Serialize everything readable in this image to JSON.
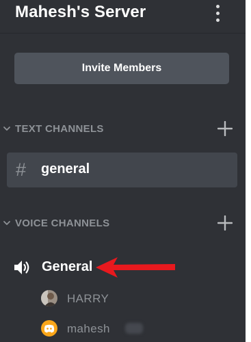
{
  "server": {
    "title": "Mahesh's Server",
    "menu_icon": "kebab-menu-icon"
  },
  "invite_button": {
    "label": "Invite Members"
  },
  "text_category": {
    "label": "TEXT CHANNELS",
    "expanded": true,
    "add_icon": "plus-icon"
  },
  "text_channels": [
    {
      "label": "general",
      "icon": "#",
      "selected": true
    }
  ],
  "voice_category": {
    "label": "VOICE CHANNELS",
    "expanded": true,
    "add_icon": "plus-icon"
  },
  "voice_channels": [
    {
      "label": "General",
      "icon": "speaker-icon",
      "users": [
        {
          "name": "HARRY",
          "avatar": "photo-avatar"
        },
        {
          "name": "mahesh",
          "avatar": "discord-logo-avatar",
          "name_partially_obscured": true
        }
      ]
    }
  ],
  "annotation": {
    "icon": "red-arrow-icon",
    "color": "#e8191e"
  },
  "colors": {
    "sidebar_bg": "#2f3136",
    "button_bg": "#4f545c",
    "selected_bg": "#42464d",
    "muted_text": "#8e9297",
    "discord_blurple": "#7289da",
    "discord_yellow": "#faa61a"
  }
}
